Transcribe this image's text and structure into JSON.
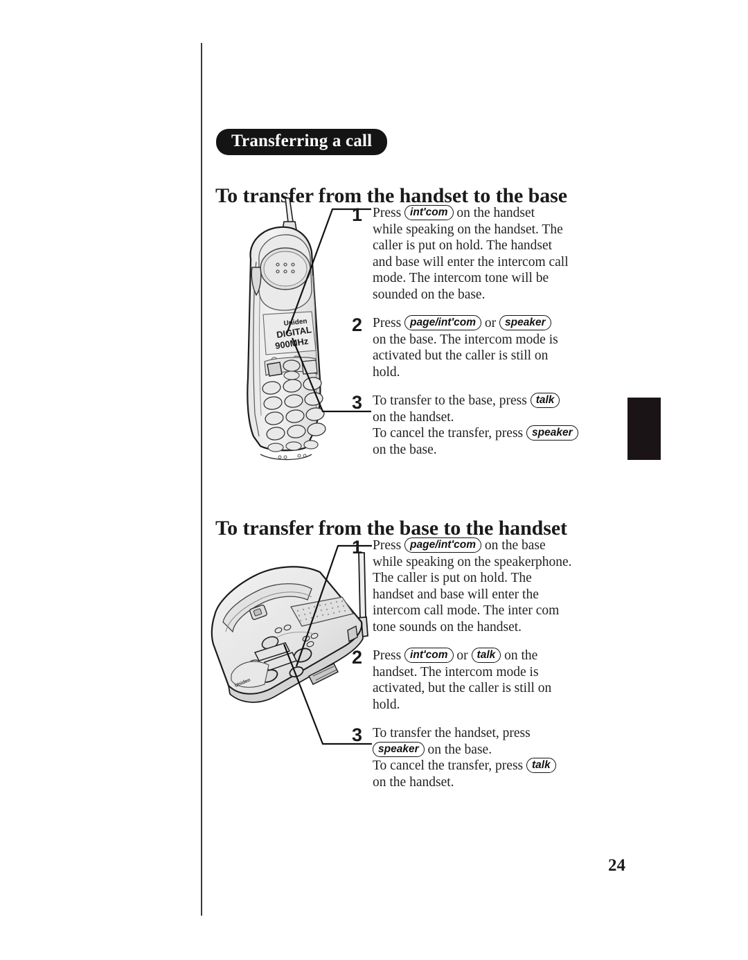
{
  "document": {
    "page_number": "24",
    "accent_black": "#141414",
    "text_color": "#1a1a1a"
  },
  "section_title": "Transferring a call",
  "sections": [
    {
      "heading": "To transfer from the handset to the base",
      "illustration": "cordless-handset-diagram",
      "steps": [
        {
          "number": "1",
          "lines": [
            {
              "parts": [
                {
                  "type": "text",
                  "value": "Press "
                },
                {
                  "type": "key",
                  "value": "int'com"
                },
                {
                  "type": "text",
                  "value": " on the handset"
                }
              ]
            },
            {
              "parts": [
                {
                  "type": "text",
                  "value": "while speaking on the handset. The"
                }
              ]
            },
            {
              "parts": [
                {
                  "type": "text",
                  "value": "caller is put on hold. The handset"
                }
              ]
            },
            {
              "parts": [
                {
                  "type": "text",
                  "value": "and base will enter the intercom call"
                }
              ]
            },
            {
              "parts": [
                {
                  "type": "text",
                  "value": "mode. The intercom tone will be"
                }
              ]
            },
            {
              "parts": [
                {
                  "type": "text",
                  "value": "sounded on  the base."
                }
              ]
            }
          ]
        },
        {
          "number": "2",
          "lines": [
            {
              "parts": [
                {
                  "type": "text",
                  "value": "Press "
                },
                {
                  "type": "key",
                  "value": "page/int'com"
                },
                {
                  "type": "text",
                  "value": " or "
                },
                {
                  "type": "key",
                  "value": "speaker"
                }
              ]
            },
            {
              "parts": [
                {
                  "type": "text",
                  "value": "on the base. The intercom mode is"
                }
              ]
            },
            {
              "parts": [
                {
                  "type": "text",
                  "value": "activated but the caller is still on"
                }
              ]
            },
            {
              "parts": [
                {
                  "type": "text",
                  "value": "hold."
                }
              ]
            }
          ]
        },
        {
          "number": "3",
          "lines": [
            {
              "parts": [
                {
                  "type": "text",
                  "value": "To transfer to the base, press "
                },
                {
                  "type": "key",
                  "value": "talk"
                }
              ]
            },
            {
              "parts": [
                {
                  "type": "text",
                  "value": "on the handset."
                }
              ]
            },
            {
              "parts": [
                {
                  "type": "text",
                  "value": "To cancel the transfer, press "
                },
                {
                  "type": "key",
                  "value": "speaker"
                }
              ]
            },
            {
              "parts": [
                {
                  "type": "text",
                  "value": "on the base."
                }
              ]
            }
          ]
        }
      ]
    },
    {
      "heading": "To transfer from the base to the handset",
      "illustration": "cordless-base-diagram",
      "steps": [
        {
          "number": "1",
          "lines": [
            {
              "parts": [
                {
                  "type": "text",
                  "value": "Press "
                },
                {
                  "type": "key",
                  "value": "page/int'com"
                },
                {
                  "type": "text",
                  "value": " on the base"
                }
              ]
            },
            {
              "parts": [
                {
                  "type": "text",
                  "value": "while speaking on the speakerphone."
                }
              ]
            },
            {
              "parts": [
                {
                  "type": "text",
                  "value": "The caller is put on hold. The"
                }
              ]
            },
            {
              "parts": [
                {
                  "type": "text",
                  "value": "handset and base will enter the"
                }
              ]
            },
            {
              "parts": [
                {
                  "type": "text",
                  "value": "intercom call mode. The inter com"
                }
              ]
            },
            {
              "parts": [
                {
                  "type": "text",
                  "value": "tone sounds on the handset."
                }
              ]
            }
          ]
        },
        {
          "number": "2",
          "lines": [
            {
              "parts": [
                {
                  "type": "text",
                  "value": "Press "
                },
                {
                  "type": "key",
                  "value": "int'com"
                },
                {
                  "type": "text",
                  "value": " or "
                },
                {
                  "type": "key",
                  "value": "talk"
                },
                {
                  "type": "text",
                  "value": " on the"
                }
              ]
            },
            {
              "parts": [
                {
                  "type": "text",
                  "value": "handset. The intercom mode is"
                }
              ]
            },
            {
              "parts": [
                {
                  "type": "text",
                  "value": "activated, but the caller is still on"
                }
              ]
            },
            {
              "parts": [
                {
                  "type": "text",
                  "value": "hold."
                }
              ]
            }
          ]
        },
        {
          "number": "3",
          "lines": [
            {
              "parts": [
                {
                  "type": "text",
                  "value": "To transfer the handset, press"
                }
              ]
            },
            {
              "parts": [
                {
                  "type": "key",
                  "value": "speaker"
                },
                {
                  "type": "text",
                  "value": " on the base."
                }
              ]
            },
            {
              "parts": [
                {
                  "type": "text",
                  "value": "To cancel the transfer, press "
                },
                {
                  "type": "key",
                  "value": "talk"
                }
              ]
            },
            {
              "parts": [
                {
                  "type": "text",
                  "value": "on the handset."
                }
              ]
            }
          ]
        }
      ]
    }
  ],
  "handset_labels": {
    "brand": "Uniden",
    "line1": "DIGITAL",
    "line2": "900MHz"
  },
  "base_labels": {
    "brand": "Uniden"
  }
}
